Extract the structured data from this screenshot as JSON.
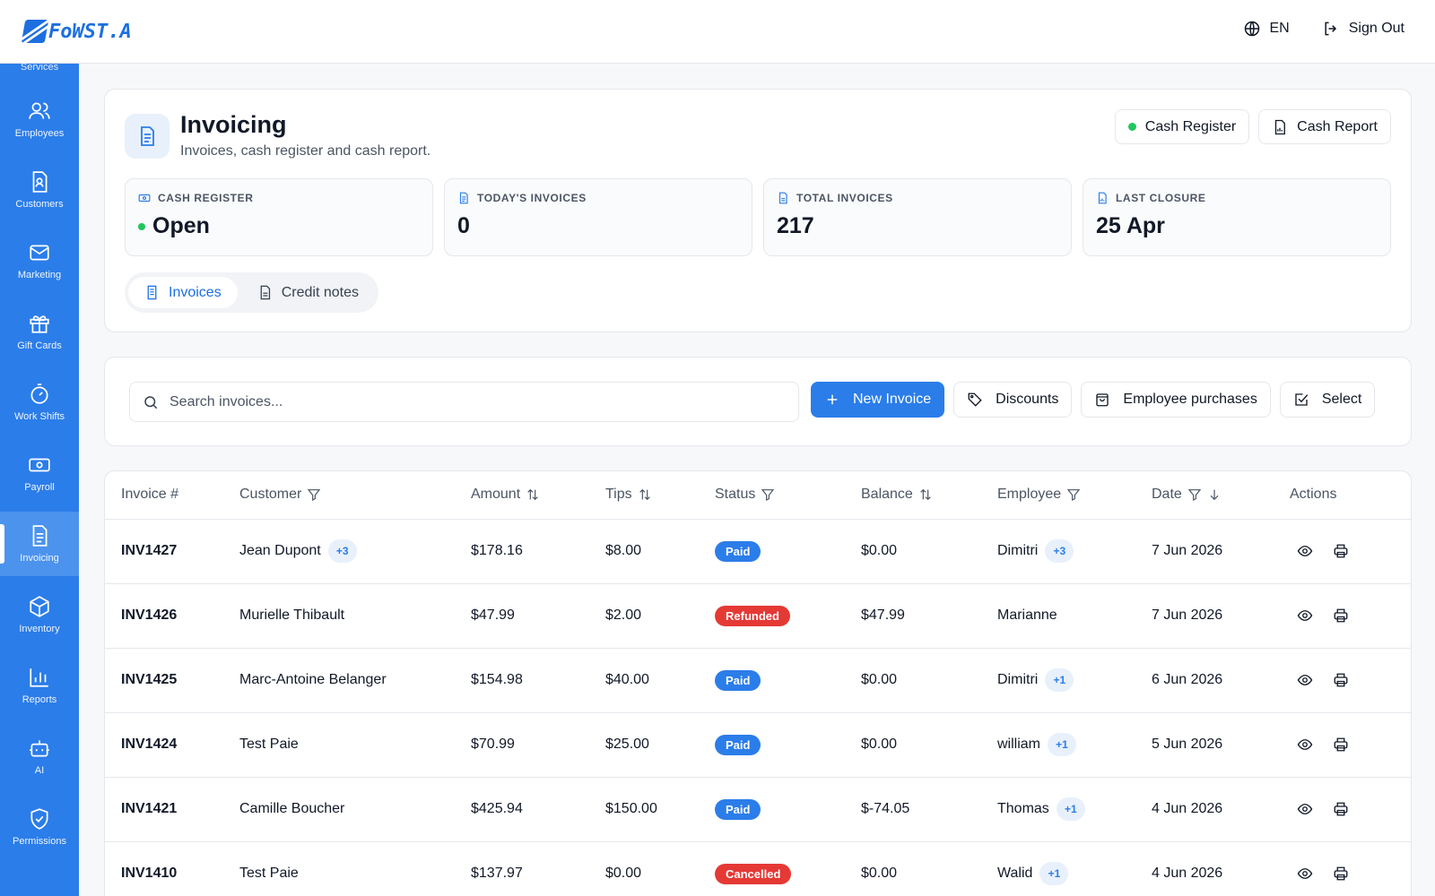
{
  "app": {
    "logo_text": "FoWST.A"
  },
  "topbar": {
    "language": "EN",
    "sign_out": "Sign Out"
  },
  "sidebar": {
    "partial_label": "Services",
    "items": [
      {
        "label": "Employees",
        "icon": "users-icon"
      },
      {
        "label": "Customers",
        "icon": "customer-card-icon"
      },
      {
        "label": "Marketing",
        "icon": "mail-icon"
      },
      {
        "label": "Gift Cards",
        "icon": "gift-icon"
      },
      {
        "label": "Work Shifts",
        "icon": "timer-icon"
      },
      {
        "label": "Payroll",
        "icon": "banknote-icon"
      },
      {
        "label": "Invoicing",
        "icon": "invoice-icon",
        "active": true
      },
      {
        "label": "Inventory",
        "icon": "box-icon"
      },
      {
        "label": "Reports",
        "icon": "bar-chart-icon"
      },
      {
        "label": "AI",
        "icon": "bot-icon"
      },
      {
        "label": "Permissions",
        "icon": "shield-check-icon"
      }
    ]
  },
  "header": {
    "title": "Invoicing",
    "subtitle": "Invoices, cash register and cash report.",
    "cash_register_btn": "Cash Register",
    "cash_report_btn": "Cash Report"
  },
  "stats": {
    "cash_register": {
      "label": "CASH REGISTER",
      "value": "Open"
    },
    "todays_invoices": {
      "label": "TODAY'S INVOICES",
      "value": "0"
    },
    "total_invoices": {
      "label": "TOTAL INVOICES",
      "value": "217"
    },
    "last_closure": {
      "label": "LAST CLOSURE",
      "value": "25 Apr"
    }
  },
  "tabs": {
    "invoices": "Invoices",
    "credit_notes": "Credit notes"
  },
  "toolbar": {
    "search_placeholder": "Search invoices...",
    "new_invoice": "New Invoice",
    "discounts": "Discounts",
    "employee_purchases": "Employee purchases",
    "select": "Select"
  },
  "table": {
    "columns": {
      "invoice": "Invoice #",
      "customer": "Customer",
      "amount": "Amount",
      "tips": "Tips",
      "status": "Status",
      "balance": "Balance",
      "employee": "Employee",
      "date": "Date",
      "actions": "Actions"
    },
    "rows": [
      {
        "invoice": "INV1427",
        "customer": "Jean Dupont",
        "customer_more": "+3",
        "amount": "$178.16",
        "tips": "$8.00",
        "status": "Paid",
        "balance": "$0.00",
        "employee": "Dimitri",
        "employee_more": "+3",
        "date": "7 Jun 2026"
      },
      {
        "invoice": "INV1426",
        "customer": "Murielle Thibault",
        "customer_more": "",
        "amount": "$47.99",
        "tips": "$2.00",
        "status": "Refunded",
        "balance": "$47.99",
        "employee": "Marianne",
        "employee_more": "",
        "date": "7 Jun 2026"
      },
      {
        "invoice": "INV1425",
        "customer": "Marc-Antoine Belanger",
        "customer_more": "",
        "amount": "$154.98",
        "tips": "$40.00",
        "status": "Paid",
        "balance": "$0.00",
        "employee": "Dimitri",
        "employee_more": "+1",
        "date": "6 Jun 2026"
      },
      {
        "invoice": "INV1424",
        "customer": "Test Paie",
        "customer_more": "",
        "amount": "$70.99",
        "tips": "$25.00",
        "status": "Paid",
        "balance": "$0.00",
        "employee": "william",
        "employee_more": "+1",
        "date": "5 Jun 2026"
      },
      {
        "invoice": "INV1421",
        "customer": "Camille Boucher",
        "customer_more": "",
        "amount": "$425.94",
        "tips": "$150.00",
        "status": "Paid",
        "balance": "$-74.05",
        "employee": "Thomas",
        "employee_more": "+1",
        "date": "4 Jun 2026"
      },
      {
        "invoice": "INV1410",
        "customer": "Test Paie",
        "customer_more": "",
        "amount": "$137.97",
        "tips": "$0.00",
        "status": "Cancelled",
        "balance": "$0.00",
        "employee": "Walid",
        "employee_more": "+1",
        "date": "4 Jun 2026"
      }
    ]
  },
  "colors": {
    "brand": "#2b7de9",
    "paid": "#2b7de9",
    "refunded": "#e53935",
    "cancelled": "#e53935",
    "open": "#22c55e"
  }
}
